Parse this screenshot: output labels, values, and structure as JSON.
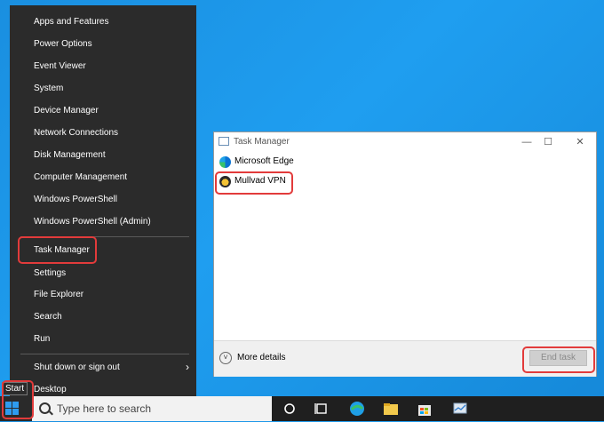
{
  "menu": {
    "items": [
      {
        "label": "Apps and Features"
      },
      {
        "label": "Power Options"
      },
      {
        "label": "Event Viewer"
      },
      {
        "label": "System"
      },
      {
        "label": "Device Manager"
      },
      {
        "label": "Network Connections"
      },
      {
        "label": "Disk Management"
      },
      {
        "label": "Computer Management"
      },
      {
        "label": "Windows PowerShell"
      },
      {
        "label": "Windows PowerShell (Admin)"
      },
      {
        "label": "Task Manager"
      },
      {
        "label": "Settings"
      },
      {
        "label": "File Explorer"
      },
      {
        "label": "Search"
      },
      {
        "label": "Run"
      },
      {
        "label": "Shut down or sign out"
      },
      {
        "label": "Desktop"
      }
    ]
  },
  "taskbar": {
    "start_tooltip": "Start",
    "search_placeholder": "Type here to search"
  },
  "task_manager": {
    "title": "Task Manager",
    "processes": [
      {
        "name": "Microsoft Edge"
      },
      {
        "name": "Mullvad VPN"
      }
    ],
    "more_details": "More details",
    "end_task": "End task"
  },
  "colors": {
    "highlight": "#e23b3b",
    "desktop": "#1a8fe0",
    "menu_bg": "#2b2b2b"
  }
}
